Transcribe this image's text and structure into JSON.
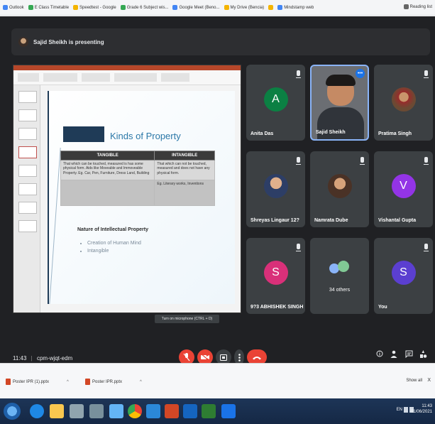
{
  "bookmarks": {
    "items": [
      {
        "label": "Outlook",
        "icon": "outlook-icon"
      },
      {
        "label": "E Class Timetable",
        "icon": "bookmark-icon"
      },
      {
        "label": "Speedtest - Google",
        "icon": "bookmark-icon"
      },
      {
        "label": "Grade 6 Subject wis...",
        "icon": "bookmark-icon"
      },
      {
        "label": "Google Meet (Beno...",
        "icon": "meet-icon"
      },
      {
        "label": "My Drive (Bencia)",
        "icon": "drive-icon"
      },
      {
        "label": "",
        "icon": "bookmark-icon"
      },
      {
        "label": "Mindstamp web",
        "icon": "bookmark-icon"
      }
    ],
    "reading_list": "Reading list"
  },
  "meet": {
    "presenting": "Sajid Sheikh is presenting",
    "time": "11:43",
    "meeting_code": "cpm-wjqt-edm",
    "tooltip": "Turn on microphone (CTRL + D)",
    "participants": [
      {
        "name": "Anita Das",
        "initial": "A",
        "color": "#0b8043"
      },
      {
        "name": "Sajid Sheikh",
        "initial": "",
        "color": "",
        "speaking": true
      },
      {
        "name": "Pratima Singh",
        "initial": "",
        "color": ""
      },
      {
        "name": "Shreyas Lingaur 12?",
        "initial": "",
        "color": ""
      },
      {
        "name": "Namrata Dube",
        "initial": "",
        "color": ""
      },
      {
        "name": "Vishantal Gupta",
        "initial": "V",
        "color": "#9334e6"
      },
      {
        "name": "9?3 ABHISHEK SINGH",
        "initial": "S",
        "color": "#d93079"
      },
      {
        "name": "34 others",
        "initial": "",
        "color": ""
      },
      {
        "name": "You",
        "initial": "S",
        "color": "#5b3fd0"
      }
    ],
    "more_icon": "•••",
    "end_call_icon": "phone-end-icon"
  },
  "slide": {
    "title": "Kinds of Property",
    "table": {
      "headers": [
        "TANGIBLE",
        "INTANGIBLE"
      ],
      "rows": [
        [
          "That which can be touched, measured is has some physical form. Aids like Moveable and Immoveable Property. Eg. Car, Pen, Furniture, Dress Land, Building",
          "That which can not be touched, measured and does not have any physical form."
        ],
        [
          "",
          "Eg. Literary works, Inventions"
        ]
      ]
    },
    "nip_title": "Nature of Intellectual Property",
    "nip_items": [
      "Creation of Human Mind",
      "Intangible"
    ]
  },
  "downloads": {
    "items": [
      "Poster IPR (1).pptx",
      "Poster IPR.pptx"
    ],
    "show_all": "Show all",
    "close": "X"
  },
  "taskbar": {
    "lang": "EN",
    "time": "11:43",
    "date": "01/06/2021"
  }
}
